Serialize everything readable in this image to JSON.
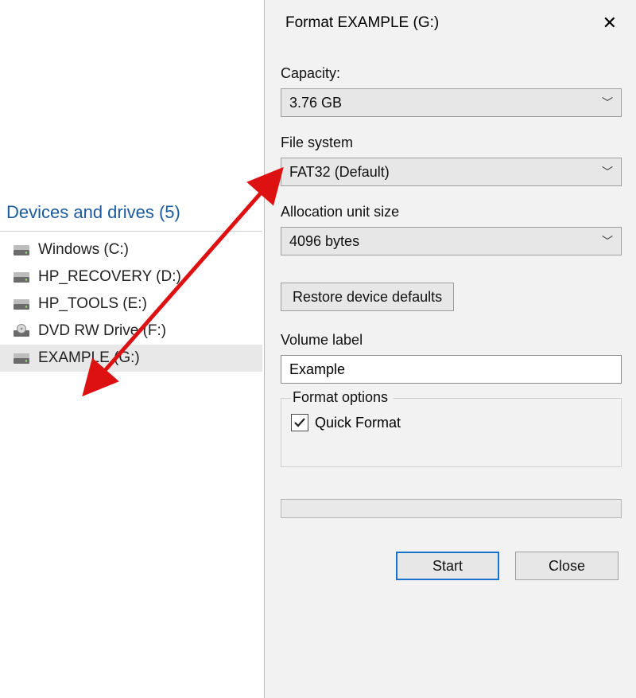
{
  "explorer": {
    "section_title": "Devices and drives (5)",
    "drives": [
      {
        "label": "Windows (C:)",
        "icon": "drive"
      },
      {
        "label": "HP_RECOVERY (D:)",
        "icon": "drive"
      },
      {
        "label": "HP_TOOLS (E:)",
        "icon": "drive"
      },
      {
        "label": "DVD RW Drive (F:)",
        "icon": "disc"
      },
      {
        "label": "EXAMPLE (G:)",
        "icon": "usb",
        "selected": true
      }
    ]
  },
  "dialog": {
    "title": "Format EXAMPLE (G:)",
    "close_glyph": "✕",
    "capacity_label": "Capacity:",
    "capacity_value": "3.76 GB",
    "filesystem_label": "File system",
    "filesystem_value": "FAT32 (Default)",
    "allocation_label": "Allocation unit size",
    "allocation_value": "4096 bytes",
    "restore_label": "Restore device defaults",
    "volume_label_label": "Volume label",
    "volume_label_value": "Example",
    "format_options_label": "Format options",
    "quick_format_label": "Quick Format",
    "quick_format_checked": true,
    "start_label": "Start",
    "close_label": "Close"
  }
}
